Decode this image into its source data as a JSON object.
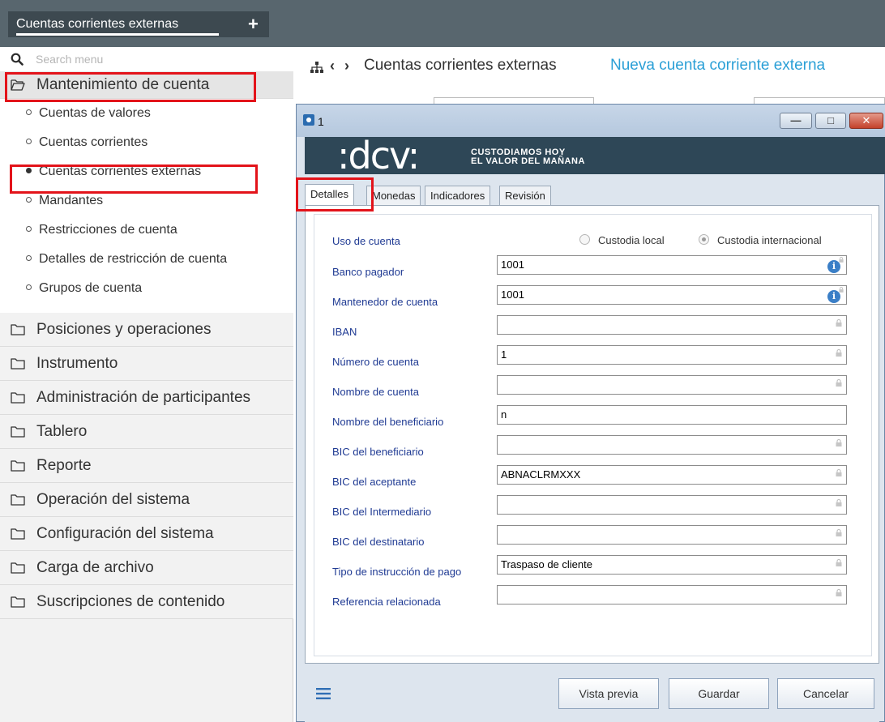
{
  "app": {
    "tab_label": "Cuentas corrientes externas",
    "add_icon": "plus-icon"
  },
  "sidebar": {
    "search_placeholder": "Search menu",
    "active_section": "Mantenimiento de cuenta",
    "sub_items": [
      {
        "label": "Cuentas de valores",
        "selected": false
      },
      {
        "label": "Cuentas corrientes",
        "selected": false
      },
      {
        "label": "Cuentas corrientes externas",
        "selected": true
      },
      {
        "label": "Mandantes",
        "selected": false
      },
      {
        "label": "Restricciones de cuenta",
        "selected": false
      },
      {
        "label": "Detalles de restricción de cuenta",
        "selected": false
      },
      {
        "label": "Grupos de cuenta",
        "selected": false
      }
    ],
    "sections": [
      "Posiciones y operaciones",
      "Instrumento",
      "Administración de participantes",
      "Tablero",
      "Reporte",
      "Operación del sistema",
      "Configuración del sistema",
      "Carga de archivo",
      "Suscripciones de contenido"
    ]
  },
  "header": {
    "title": "Cuentas corrientes externas",
    "link": "Nueva cuenta corriente externa"
  },
  "dialog": {
    "title": "1",
    "tagline_1": "CUSTODIAMOS HOY",
    "tagline_2": "EL VALOR DEL MAÑANA",
    "tabs": [
      "Detalles",
      "Monedas",
      "Indicadores",
      "Revisión"
    ],
    "active_tab": "Detalles",
    "form": {
      "uso_label": "Uso de cuenta",
      "radio_local": "Custodia local",
      "radio_internacional": "Custodia internacional",
      "selected_radio": "Custodia internacional",
      "fields": [
        {
          "label": "Banco pagador",
          "value": "1001"
        },
        {
          "label": "Mantenedor de cuenta",
          "value": "1001"
        },
        {
          "label": "IBAN",
          "value": ""
        },
        {
          "label": "Número de cuenta",
          "value": "1"
        },
        {
          "label": "Nombre de cuenta",
          "value": ""
        },
        {
          "label": "Nombre del beneficiario",
          "value": "n"
        },
        {
          "label": "BIC del beneficiario",
          "value": ""
        },
        {
          "label": "BIC del aceptante",
          "value": "ABNACLRMXXX"
        },
        {
          "label": "BIC del Intermediario",
          "value": ""
        },
        {
          "label": "BIC del destinatario",
          "value": ""
        },
        {
          "label": "Tipo de instrucción de pago",
          "value": "Traspaso de cliente"
        },
        {
          "label": "Referencia relacionada",
          "value": ""
        }
      ]
    },
    "buttons": {
      "preview": "Vista previa",
      "save": "Guardar",
      "cancel": "Cancelar"
    }
  },
  "colors": {
    "topbar": "#58666e",
    "link": "#2a9fd6",
    "label": "#1f3a93",
    "highlight": "#e3131a",
    "banner": "#2e4757"
  }
}
